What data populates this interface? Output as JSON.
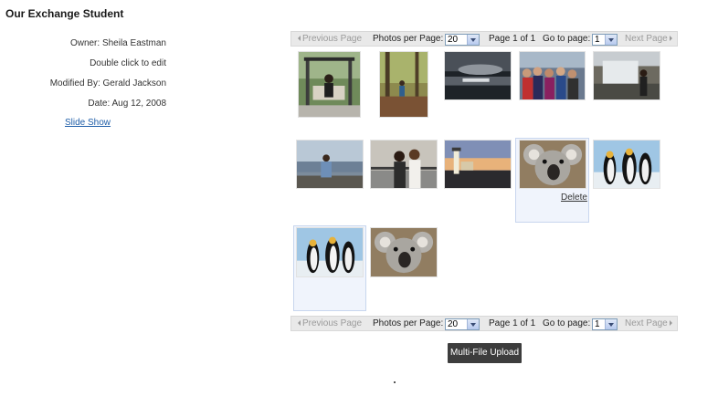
{
  "page": {
    "title": "Our Exchange Student"
  },
  "details": {
    "owner": "Owner: Sheila Eastman",
    "edit_hint": "Double click to edit",
    "modified_by": "Modified By: Gerald Jackson",
    "date": "Date: Aug 12, 2008",
    "slideshow_link": "Slide Show"
  },
  "pager": {
    "prev_label": "Previous Page",
    "per_page_label": "Photos per Page:",
    "per_page_value": "20",
    "page_info": "Page 1 of 1",
    "goto_label": "Go to page:",
    "goto_value": "1",
    "next_label": "Next Page"
  },
  "photos": [
    {
      "subject": "girl on swing bench"
    },
    {
      "subject": "girl in forest"
    },
    {
      "subject": "sunset over water"
    },
    {
      "subject": "group of friends"
    },
    {
      "subject": "waterfall"
    },
    {
      "subject": "girl at lake shore"
    },
    {
      "subject": "two girls at railing"
    },
    {
      "subject": "lighthouse at dusk"
    },
    {
      "subject": "koala"
    },
    {
      "subject": "penguins"
    },
    {
      "subject": "penguins"
    },
    {
      "subject": "koala"
    }
  ],
  "selected_photo_action": "Delete",
  "upload_button": "Multi-File Upload"
}
